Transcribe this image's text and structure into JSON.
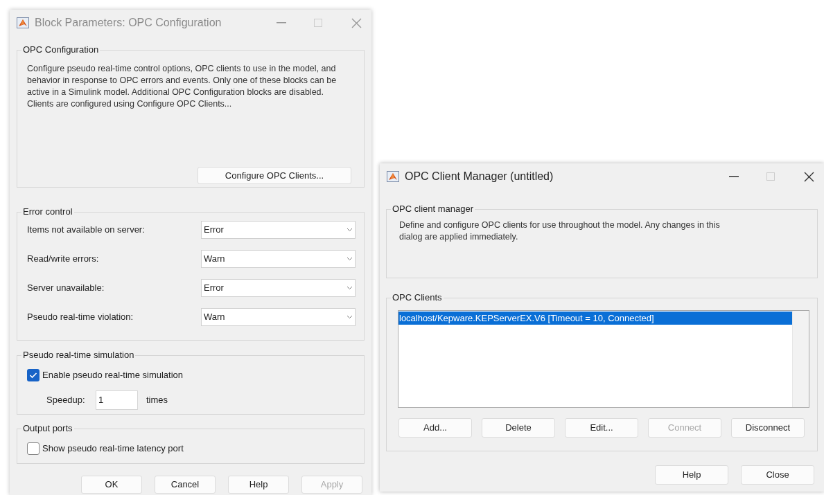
{
  "block_parameters": {
    "title": "Block Parameters: OPC Configuration",
    "active": false,
    "description": {
      "legend": "OPC Configuration",
      "text": "Configure pseudo real-time control options, OPC clients to use in the model, and behavior in response to OPC errors and events. Only one of these blocks can be active in a Simulink model. Additional OPC Configuration blocks are disabled. Clients are configured using Configure OPC Clients...",
      "button": "Configure OPC Clients..."
    },
    "error_control": {
      "legend": "Error control",
      "rows": [
        {
          "label": "Items not available on server:",
          "value": "Error"
        },
        {
          "label": "Read/write errors:",
          "value": "Warn"
        },
        {
          "label": "Server unavailable:",
          "value": "Error"
        },
        {
          "label": "Pseudo real-time violation:",
          "value": "Warn"
        }
      ]
    },
    "simulation": {
      "legend": "Pseudo real-time simulation",
      "checkbox": {
        "label": "Enable pseudo real-time simulation",
        "checked": true
      },
      "speedup_label": "Speedup:",
      "speedup_value": "1",
      "speedup_unit": "times"
    },
    "output_ports": {
      "legend": "Output ports",
      "checkbox": {
        "label": "Show pseudo real-time latency port",
        "checked": false
      }
    },
    "buttons": [
      {
        "label": "OK",
        "disabled": false
      },
      {
        "label": "Cancel",
        "disabled": false
      },
      {
        "label": "Help",
        "disabled": false
      },
      {
        "label": "Apply",
        "disabled": true
      }
    ]
  },
  "client_manager": {
    "title": "OPC Client Manager (untitled)",
    "active": true,
    "description": {
      "legend": "OPC client manager",
      "text": "Define and configure OPC clients for use throughout the model. Any changes in this dialog are applied immediately."
    },
    "clients": {
      "legend": "OPC Clients",
      "items": [
        {
          "label": "localhost/Kepware.KEPServerEX.V6 [Timeout = 10, Connected]",
          "selected": true
        }
      ],
      "buttons": [
        {
          "label": "Add...",
          "disabled": false
        },
        {
          "label": "Delete",
          "disabled": false
        },
        {
          "label": "Edit...",
          "disabled": false
        },
        {
          "label": "Connect",
          "disabled": true
        },
        {
          "label": "Disconnect",
          "disabled": false
        }
      ]
    },
    "buttons": [
      {
        "label": "Help",
        "disabled": false
      },
      {
        "label": "Close",
        "disabled": false
      }
    ]
  }
}
